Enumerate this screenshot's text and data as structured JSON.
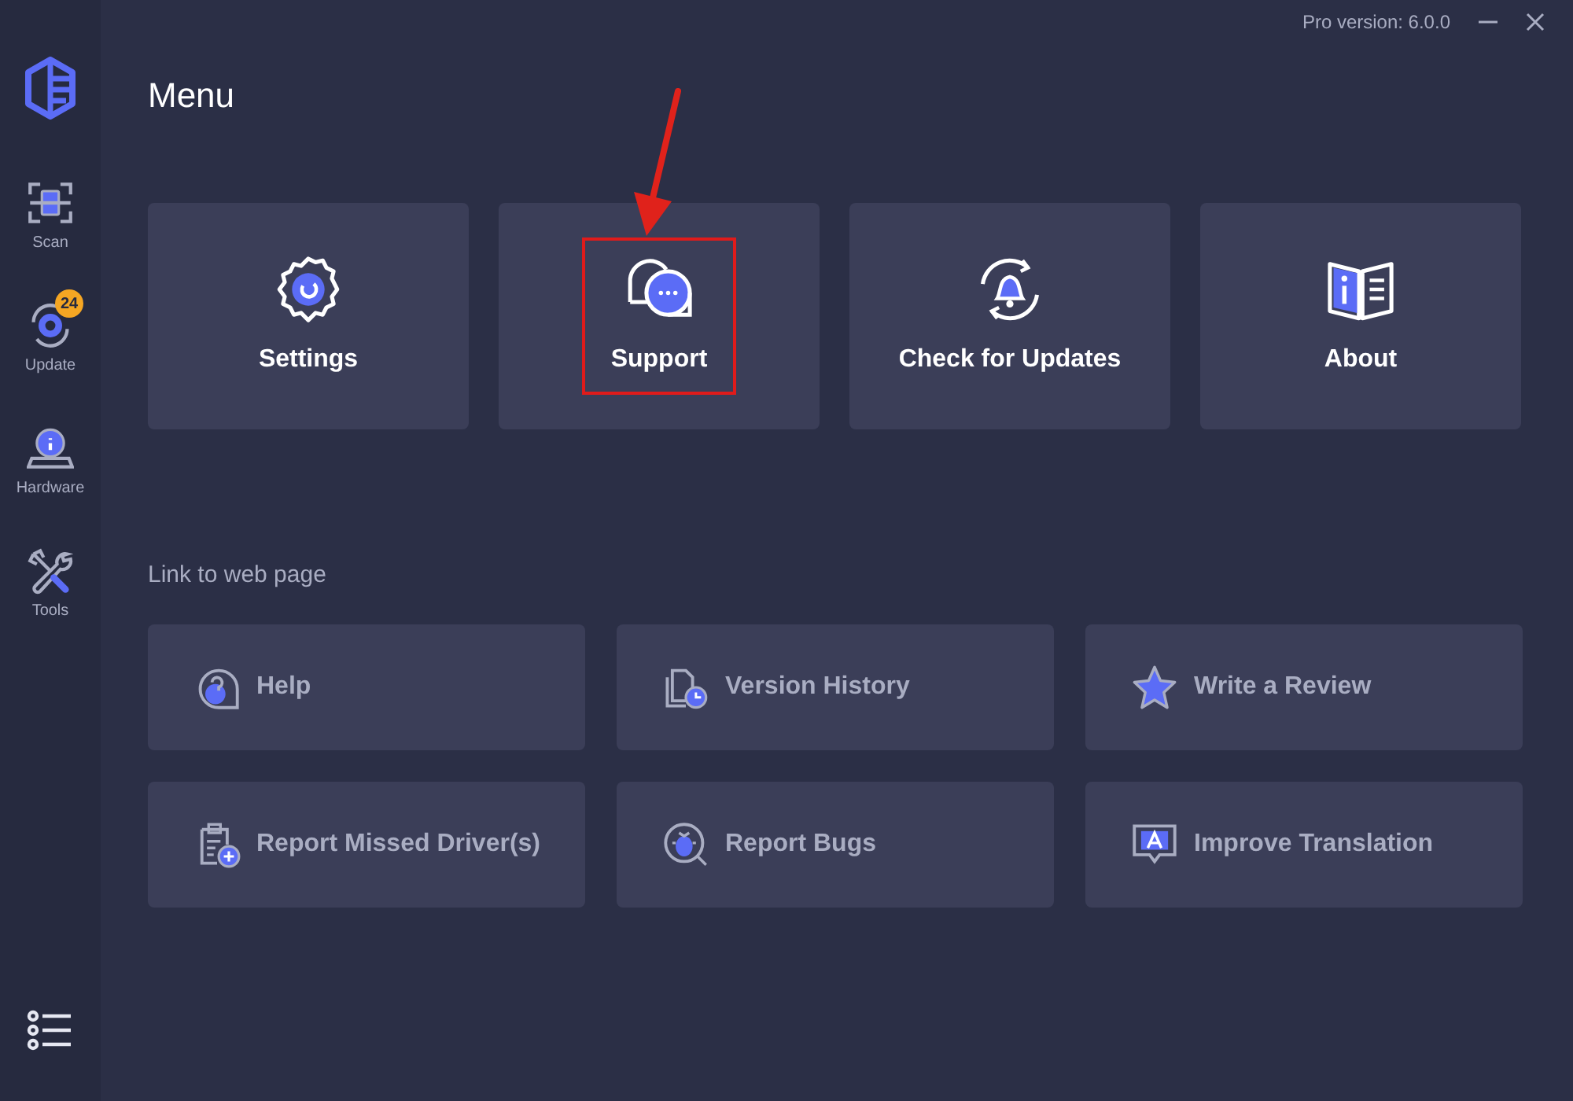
{
  "window": {
    "version": "Pro version: 6.0.0"
  },
  "sidebar": {
    "items": [
      {
        "kind": "scan",
        "label": "Scan"
      },
      {
        "kind": "update",
        "label": "Update",
        "badge": "24"
      },
      {
        "kind": "hardware",
        "label": "Hardware"
      },
      {
        "kind": "tools",
        "label": "Tools"
      }
    ]
  },
  "title": "Menu",
  "menu_cards": [
    {
      "kind": "settings",
      "label": "Settings",
      "highlighted": false
    },
    {
      "kind": "support",
      "label": "Support",
      "highlighted": true
    },
    {
      "kind": "updates",
      "label": "Check for Updates",
      "highlighted": false
    },
    {
      "kind": "about",
      "label": "About",
      "highlighted": false
    }
  ],
  "links_heading": "Link to web page",
  "links": [
    {
      "kind": "help",
      "label": "Help"
    },
    {
      "kind": "history",
      "label": "Version History"
    },
    {
      "kind": "review",
      "label": "Write a Review"
    },
    {
      "kind": "driver",
      "label": "Report Missed Driver(s)"
    },
    {
      "kind": "bug",
      "label": "Report Bugs"
    },
    {
      "kind": "translation",
      "label": "Improve Translation"
    }
  ]
}
